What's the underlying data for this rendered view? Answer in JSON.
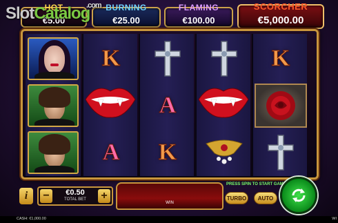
{
  "watermark": {
    "text_a": "Slot",
    "text_b": "Catalog",
    "suffix": ".com"
  },
  "jackpots": [
    {
      "name": "HOT",
      "value": "€5.00"
    },
    {
      "name": "BURNING",
      "value": "€25.00"
    },
    {
      "name": "FLAMING",
      "value": "€100.00"
    },
    {
      "name": "SCORCHER",
      "value": "€5,000.00"
    }
  ],
  "reels": {
    "reel1": [
      "vampire-woman",
      "vampire-man",
      "vampire-man"
    ],
    "reel2": [
      "K",
      "lips",
      "A"
    ],
    "reel3": [
      "cross",
      "A",
      "K"
    ],
    "reel4": [
      "cross",
      "lips",
      "brooch"
    ],
    "reel5": [
      "K",
      "rose",
      "cross"
    ]
  },
  "controls": {
    "info_label": "i",
    "bet_value": "€0.50",
    "bet_label": "TOTAL BET",
    "minus_label": "−",
    "plus_label": "+",
    "win_label": "WIN",
    "message": "PRESS SPIN TO START GAME",
    "turbo_label": "TURBO",
    "auto_label": "AUTO"
  },
  "status": {
    "cash": "CASH:  €1,000.00",
    "right": "WI"
  },
  "colors": {
    "frame_gold": "#c8963c",
    "spin_green": "#0a8a1a",
    "scorcher_red": "#7a0f12"
  }
}
